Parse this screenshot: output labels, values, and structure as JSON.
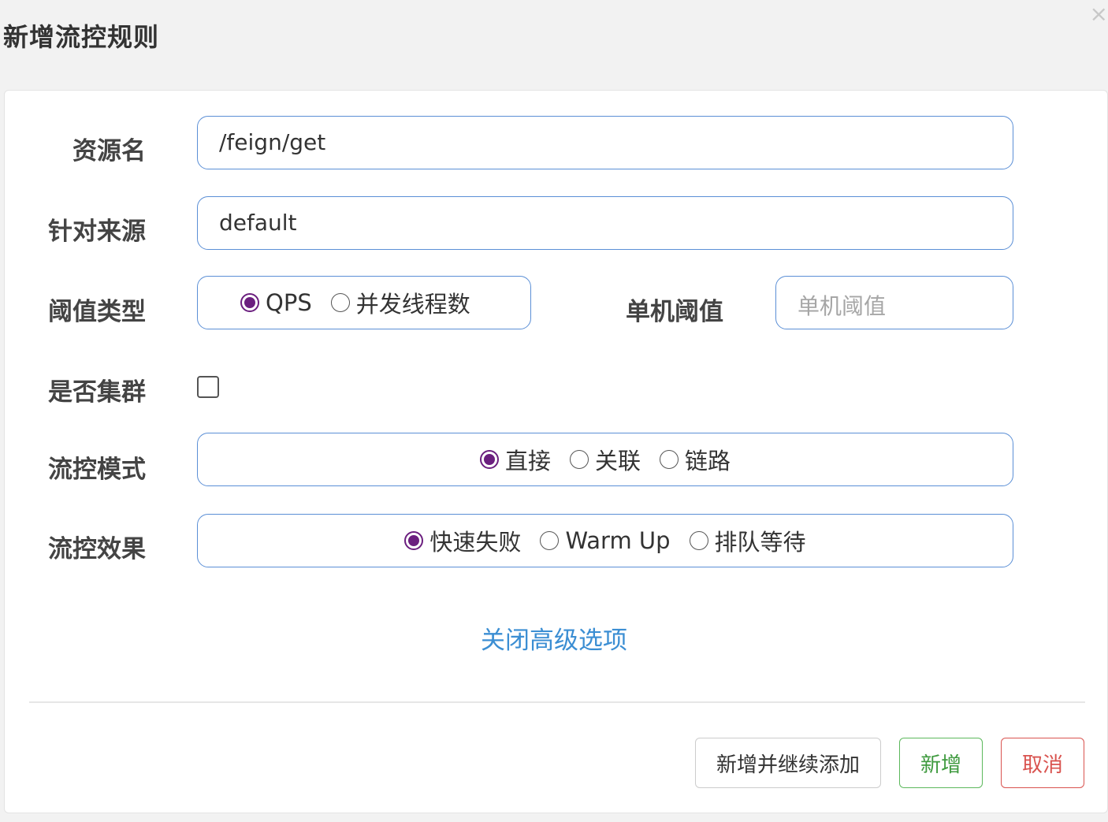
{
  "dialog": {
    "title": "新增流控规则",
    "close_glyph": "›"
  },
  "form": {
    "resource": {
      "label": "资源名",
      "value": "/feign/get"
    },
    "origin": {
      "label": "针对来源",
      "value": "default"
    },
    "threshold_type": {
      "label": "阈值类型",
      "options": [
        {
          "label": "QPS",
          "selected": true
        },
        {
          "label": "并发线程数",
          "selected": false
        }
      ]
    },
    "single_threshold": {
      "label": "单机阈值",
      "placeholder": "单机阈值",
      "value": ""
    },
    "cluster": {
      "label": "是否集群",
      "checked": false
    },
    "flow_mode": {
      "label": "流控模式",
      "options": [
        {
          "label": "直接",
          "selected": true
        },
        {
          "label": "关联",
          "selected": false
        },
        {
          "label": "链路",
          "selected": false
        }
      ]
    },
    "flow_effect": {
      "label": "流控效果",
      "options": [
        {
          "label": "快速失败",
          "selected": true
        },
        {
          "label": "Warm Up",
          "selected": false
        },
        {
          "label": "排队等待",
          "selected": false
        }
      ]
    },
    "advanced_toggle": "关闭高级选项"
  },
  "footer": {
    "add_continue": "新增并继续添加",
    "add": "新增",
    "cancel": "取消"
  },
  "colors": {
    "accent_radio": "#6b1f7f",
    "input_border": "#5b8fd6",
    "link": "#3b8ed3",
    "add_button": "#5cb85c",
    "cancel_button": "#d9534f"
  }
}
